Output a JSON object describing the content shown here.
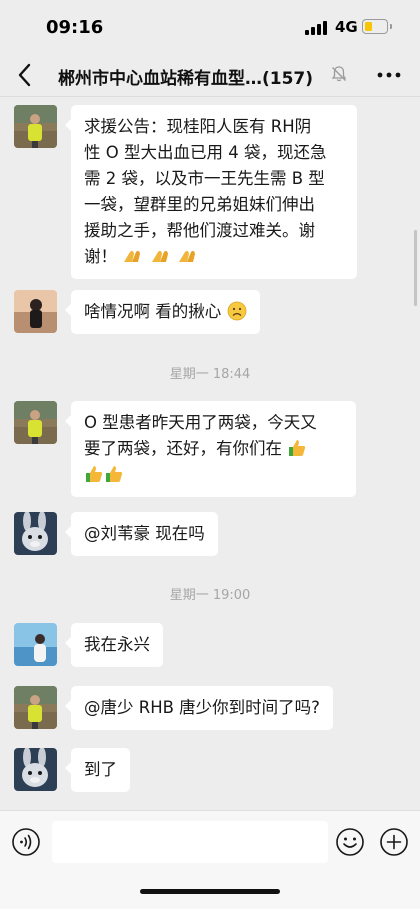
{
  "status_bar": {
    "time": "09:16",
    "network": "4G",
    "battery_level": 0.35
  },
  "header": {
    "title": "郴州市中心血站稀有血型…",
    "member_count": "(157)",
    "muted": true
  },
  "messages": [
    {
      "avatar": "avatar-man-yellow-vest",
      "text": "求援公告：现桂阳人医有 RH阴\n性 O 型大出血已用 4 袋，现还急\n需 2 袋，以及市一王先生需 B 型\n一袋，望群里的兄弟姐妹们伸出\n援助之手，帮他们渡过难关。谢\n谢！",
      "emojis": [
        "pray-emoji",
        "pray-emoji",
        "pray-emoji"
      ]
    },
    {
      "avatar": "avatar-woman-sunset",
      "text": "啥情况啊 看的揪心",
      "emojis": [
        "sad-emoji"
      ]
    },
    {
      "avatar": "avatar-man-yellow-vest",
      "text": "O 型患者昨天用了两袋，今天又\n要了两袋，还好，有你们在",
      "emojis": [
        "thumbs-up-emoji",
        "thumbs-up-emoji",
        "thumbs-up-emoji"
      ]
    },
    {
      "avatar": "avatar-cartoon-rabbit",
      "text": "@刘苇豪 现在吗"
    },
    {
      "avatar": "avatar-woman-lake",
      "text": "我在永兴"
    },
    {
      "avatar": "avatar-man-yellow-vest",
      "text": "@唐少 RHB 唐少你到时间了吗?"
    },
    {
      "avatar": "avatar-cartoon-rabbit",
      "text": "到了"
    }
  ],
  "timestamps": [
    "星期一 18:44",
    "星期一 19:00"
  ],
  "input": {
    "placeholder": ""
  },
  "icons": [
    "back-icon",
    "mute-icon",
    "more-icon",
    "voice-icon",
    "emoji-icon",
    "plus-icon"
  ]
}
